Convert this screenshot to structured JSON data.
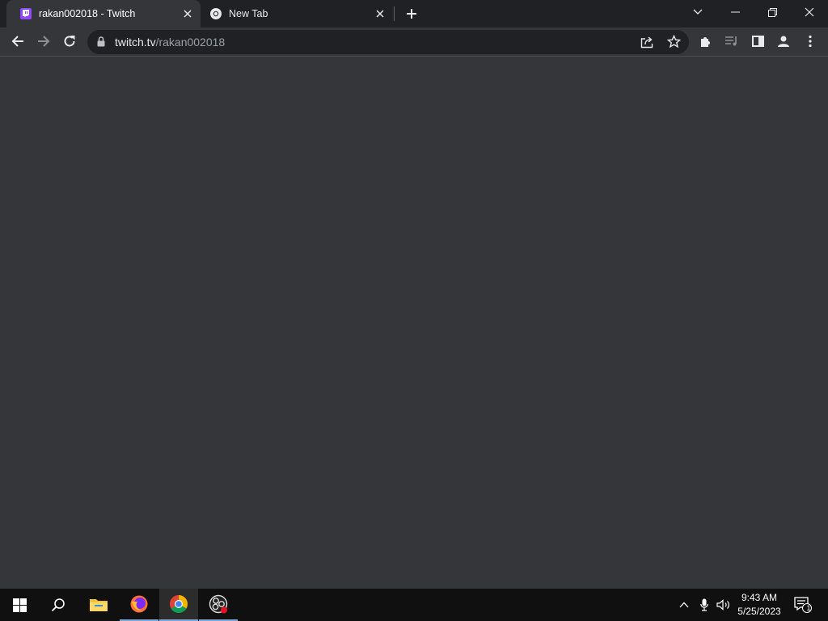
{
  "browser": {
    "tabs": [
      {
        "title": "rakan002018 - Twitch",
        "favicon": "twitch-icon",
        "active": true
      },
      {
        "title": "New Tab",
        "favicon": "chrome-icon",
        "active": false
      }
    ],
    "address": {
      "host": "twitch.tv",
      "path": "/rakan002018"
    }
  },
  "taskbar": {
    "apps": [
      "windows-start-icon",
      "search-icon",
      "file-explorer-icon",
      "firefox-icon",
      "chrome-icon",
      "obs-icon"
    ],
    "clock": {
      "time": "9:43 AM",
      "date": "5/25/2023"
    },
    "notification_count": "1"
  },
  "colors": {
    "accent_twitch": "#9146ff",
    "page_bg": "#35363a",
    "tabstrip_bg": "#202124",
    "taskbar_bg": "#101010"
  }
}
